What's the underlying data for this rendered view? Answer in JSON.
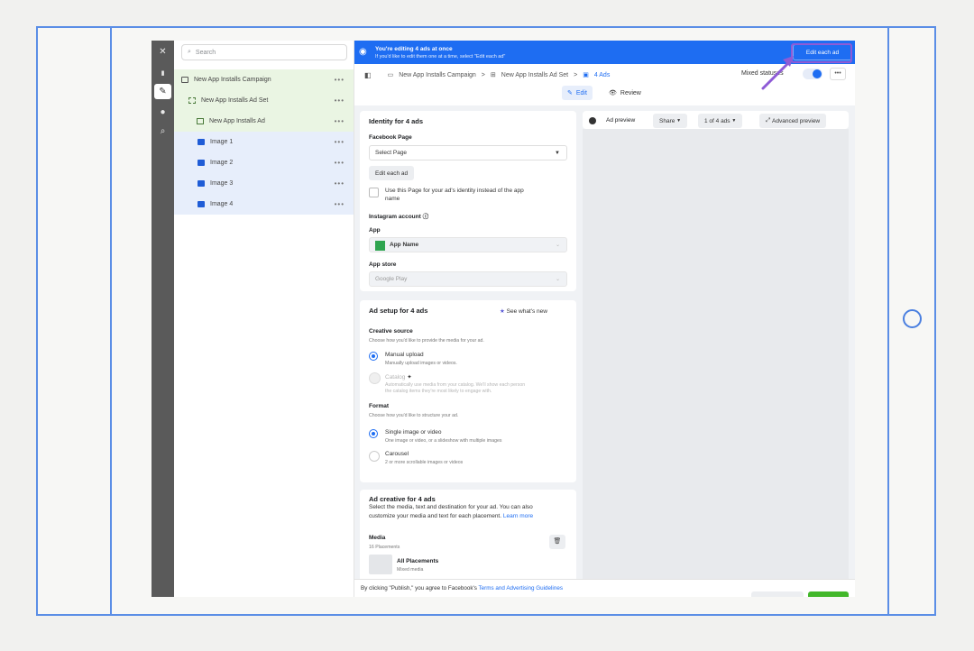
{
  "sidebar_rail": {
    "items": [
      {
        "icon": "close-icon",
        "glyph": "✕"
      },
      {
        "icon": "bar-chart-icon",
        "glyph": "▮"
      },
      {
        "icon": "pencil-icon",
        "glyph": "✎"
      },
      {
        "icon": "clock-icon",
        "glyph": "●"
      },
      {
        "icon": "search-icon",
        "glyph": "⌕"
      }
    ]
  },
  "tree": {
    "search_placeholder": "Search",
    "rows": [
      {
        "label": "New App Installs Campaign",
        "more": "•••"
      },
      {
        "label": "New App Installs Ad Set",
        "more": "•••"
      },
      {
        "label": "New App Installs Ad",
        "more": "•••"
      },
      {
        "label": "Image 1",
        "more": "•••"
      },
      {
        "label": "Image 2",
        "more": "•••"
      },
      {
        "label": "Image 3",
        "more": "•••"
      },
      {
        "label": "Image 4",
        "more": "•••"
      }
    ]
  },
  "banner": {
    "title": "You're editing 4 ads at once",
    "subtitle": "If you'd like to edit them one at a time, select \"Edit each ad\"",
    "button": "Edit each ad"
  },
  "breadcrumb": {
    "campaign": "New App Installs Campaign",
    "adset": "New App Installs Ad Set",
    "ads": "4 Ads",
    "separator": ">"
  },
  "status": {
    "mixed": "Mixed statuses",
    "more": "•••"
  },
  "tabs": {
    "edit": "Edit",
    "review": "Review"
  },
  "identity": {
    "heading": "Identity for 4 ads",
    "facebook_page_label": "Facebook Page",
    "facebook_page_value": "Select Page",
    "edit_each_button": "Edit each ad",
    "use_page_checkbox": "Use this Page for your ad's identity instead of the app",
    "use_page_checkbox_2": "name",
    "instagram_label": "Instagram account",
    "app_label": "App",
    "app_value": "App Name",
    "app_store_label": "App store",
    "app_store_value": "Google Play"
  },
  "ad_setup": {
    "heading": "Ad setup for 4 ads",
    "whats_new": "See what's new",
    "creative_source_label": "Creative source",
    "creative_source_help": "Choose how you'd like to provide the media for your ad.",
    "manual_upload": "Manual upload",
    "manual_upload_desc": "Manually upload images or videos.",
    "catalog": "Catalog",
    "catalog_desc_1": "Automatically use media from your catalog. We'll show each person",
    "catalog_desc_2": "the catalog items they're most likely to engage with.",
    "format_label": "Format",
    "format_help": "Choose how you'd like to structure your ad.",
    "single": "Single image or video",
    "single_desc": "One image or video, or a slideshow with multiple images",
    "carousel": "Carousel",
    "carousel_desc": "2 or more scrollable images or videos"
  },
  "ad_creative": {
    "heading": "Ad creative for 4 ads",
    "desc_1": "Select the media, text and destination for your ad. You can also",
    "desc_2": "customize your media and text for each placement.",
    "learn_more": "Learn more",
    "media_label": "Media",
    "placements": "16 Placements",
    "all_placements": "All Placements",
    "mixed_media": "Mixed media"
  },
  "preview": {
    "label": "Ad preview",
    "share": "Share",
    "count": "1 of 4 ads",
    "advanced": "Advanced preview"
  },
  "footer": {
    "text_prefix": "By clicking \"Publish,\" you agree to Facebook's",
    "terms_link": "Terms and Advertising Guidelines"
  },
  "colors": {
    "accent": "#1e6df2",
    "frame": "#5b8ee6",
    "arrow": "#8e5bd6",
    "publish": "#42b72a"
  }
}
